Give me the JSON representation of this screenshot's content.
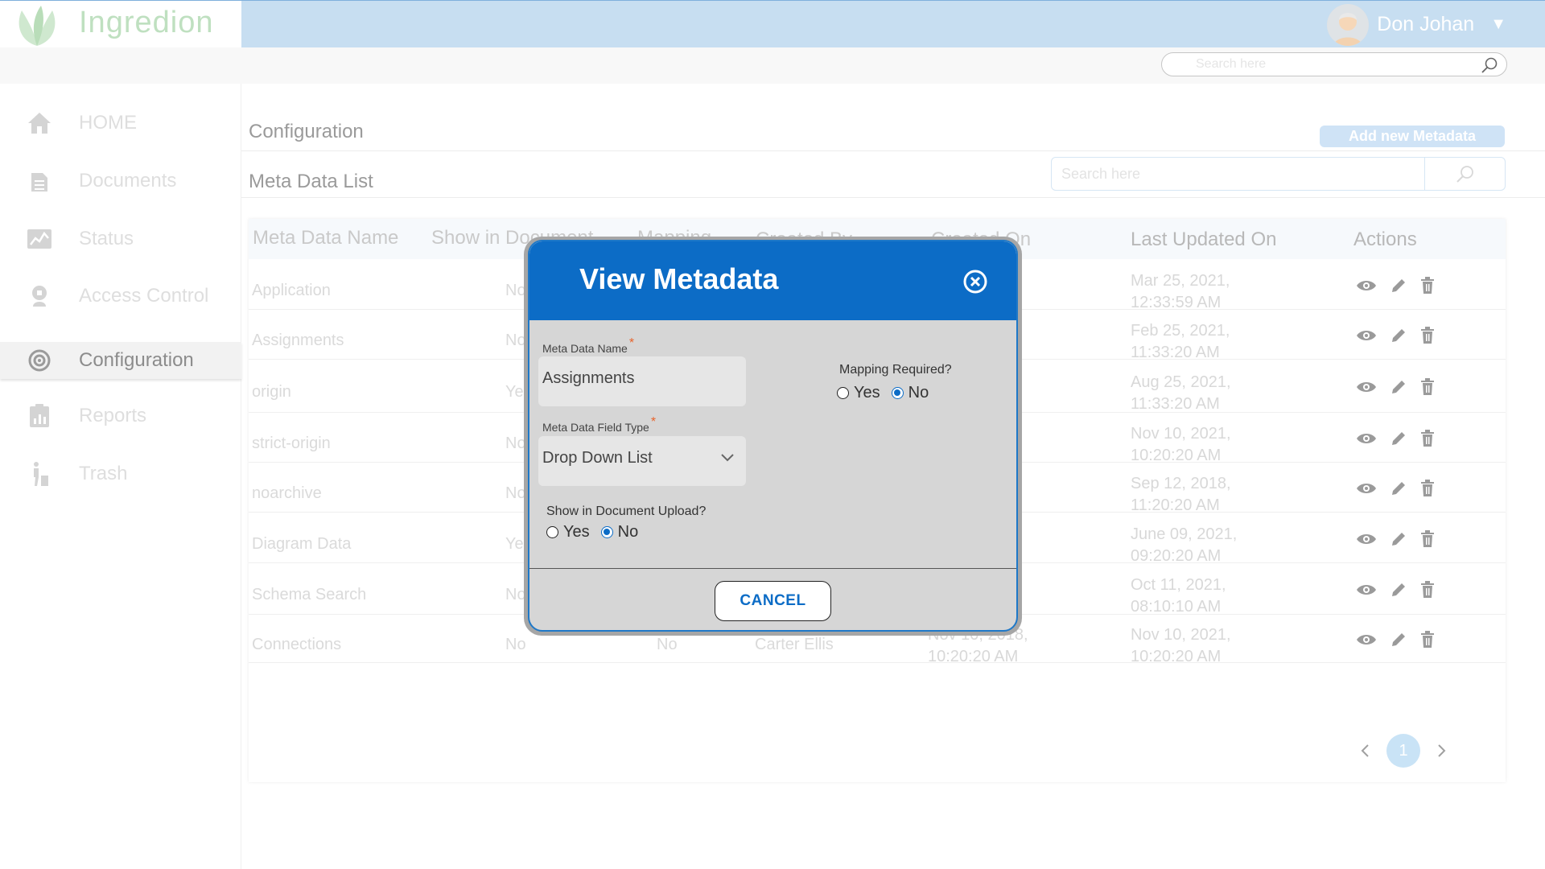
{
  "app": {
    "name": "Ingredion"
  },
  "user": {
    "name": "Don Johan"
  },
  "header_search": {
    "placeholder": "Search here"
  },
  "sidebar": {
    "items": [
      {
        "label": "HOME",
        "icon": "home-icon"
      },
      {
        "label": "Documents",
        "icon": "document-icon"
      },
      {
        "label": "Status",
        "icon": "status-chart-icon"
      },
      {
        "label": "Access Control",
        "icon": "access-control-icon"
      },
      {
        "label": "Configuration",
        "icon": "configuration-gear-icon",
        "active": true
      },
      {
        "label": "Reports",
        "icon": "reports-icon"
      },
      {
        "label": "Trash",
        "icon": "trash-person-icon"
      }
    ]
  },
  "page": {
    "title": "Configuration",
    "subtitle": "Meta Data List",
    "add_button": "Add new Metadata"
  },
  "list_search": {
    "placeholder": "Search here"
  },
  "table": {
    "headers": [
      "Meta Data Name",
      "Show in Document",
      "Mapping",
      "Created By",
      "Created On",
      "Last Updated On",
      "Actions"
    ],
    "rows": [
      {
        "name": "Application",
        "show": "No",
        "mapping": "",
        "created_by": "",
        "created_on_date": "",
        "created_on_time": "",
        "updated_date": "Mar 25, 2021,",
        "updated_time": "12:33:59 AM"
      },
      {
        "name": "Assignments",
        "show": "No",
        "mapping": "",
        "created_by": "",
        "created_on_date": "",
        "created_on_time": "",
        "updated_date": "Feb  25, 2021,",
        "updated_time": "11:33:20 AM"
      },
      {
        "name": "origin",
        "show": "Yes",
        "mapping": "",
        "created_by": "",
        "created_on_date": "",
        "created_on_time": "",
        "updated_date": "Aug  25, 2021,",
        "updated_time": "11:33:20 AM"
      },
      {
        "name": "strict-origin",
        "show": "No",
        "mapping": "",
        "created_by": "",
        "created_on_date": "",
        "created_on_time": "",
        "updated_date": "Nov  10, 2021,",
        "updated_time": "10:20:20 AM"
      },
      {
        "name": "noarchive",
        "show": "No",
        "mapping": "",
        "created_by": "",
        "created_on_date": "",
        "created_on_time": "",
        "updated_date": "Sep  12, 2018,",
        "updated_time": "11:20:20 AM"
      },
      {
        "name": "Diagram Data",
        "show": "Yes",
        "mapping": "",
        "created_by": "",
        "created_on_date": "",
        "created_on_time": "",
        "updated_date": "June  09, 2021,",
        "updated_time": "09:20:20 AM"
      },
      {
        "name": "Schema Search",
        "show": "No",
        "mapping": "",
        "created_by": "",
        "created_on_date": "",
        "created_on_time": "",
        "updated_date": "Oct  11, 2021,",
        "updated_time": "08:10:10 AM"
      },
      {
        "name": "Connections",
        "show": "No",
        "mapping": "No",
        "created_by": "Carter Ellis",
        "created_on_date": "Nov  10, 2018,",
        "created_on_time": "10:20:20 AM",
        "updated_date": "Nov  10, 2021,",
        "updated_time": "10:20:20 AM"
      }
    ]
  },
  "pagination": {
    "current": "1"
  },
  "modal": {
    "title": "View Metadata",
    "name_label": "Meta Data Name",
    "name_value": "Assignments",
    "type_label": "Meta Data Field Type",
    "type_value": "Drop Down List",
    "mapping_label": "Mapping Required?",
    "mapping_yes": "Yes",
    "mapping_no": "No",
    "mapping_selected": "No",
    "show_label": "Show in Document Upload?",
    "show_yes": "Yes",
    "show_no": "No",
    "show_selected": "No",
    "cancel": "CANCEL",
    "required_mark": "*"
  },
  "colors": {
    "primary": "#0c6cc6",
    "header_bg": "#c7def1",
    "logo_green": "#bfe0c0"
  }
}
